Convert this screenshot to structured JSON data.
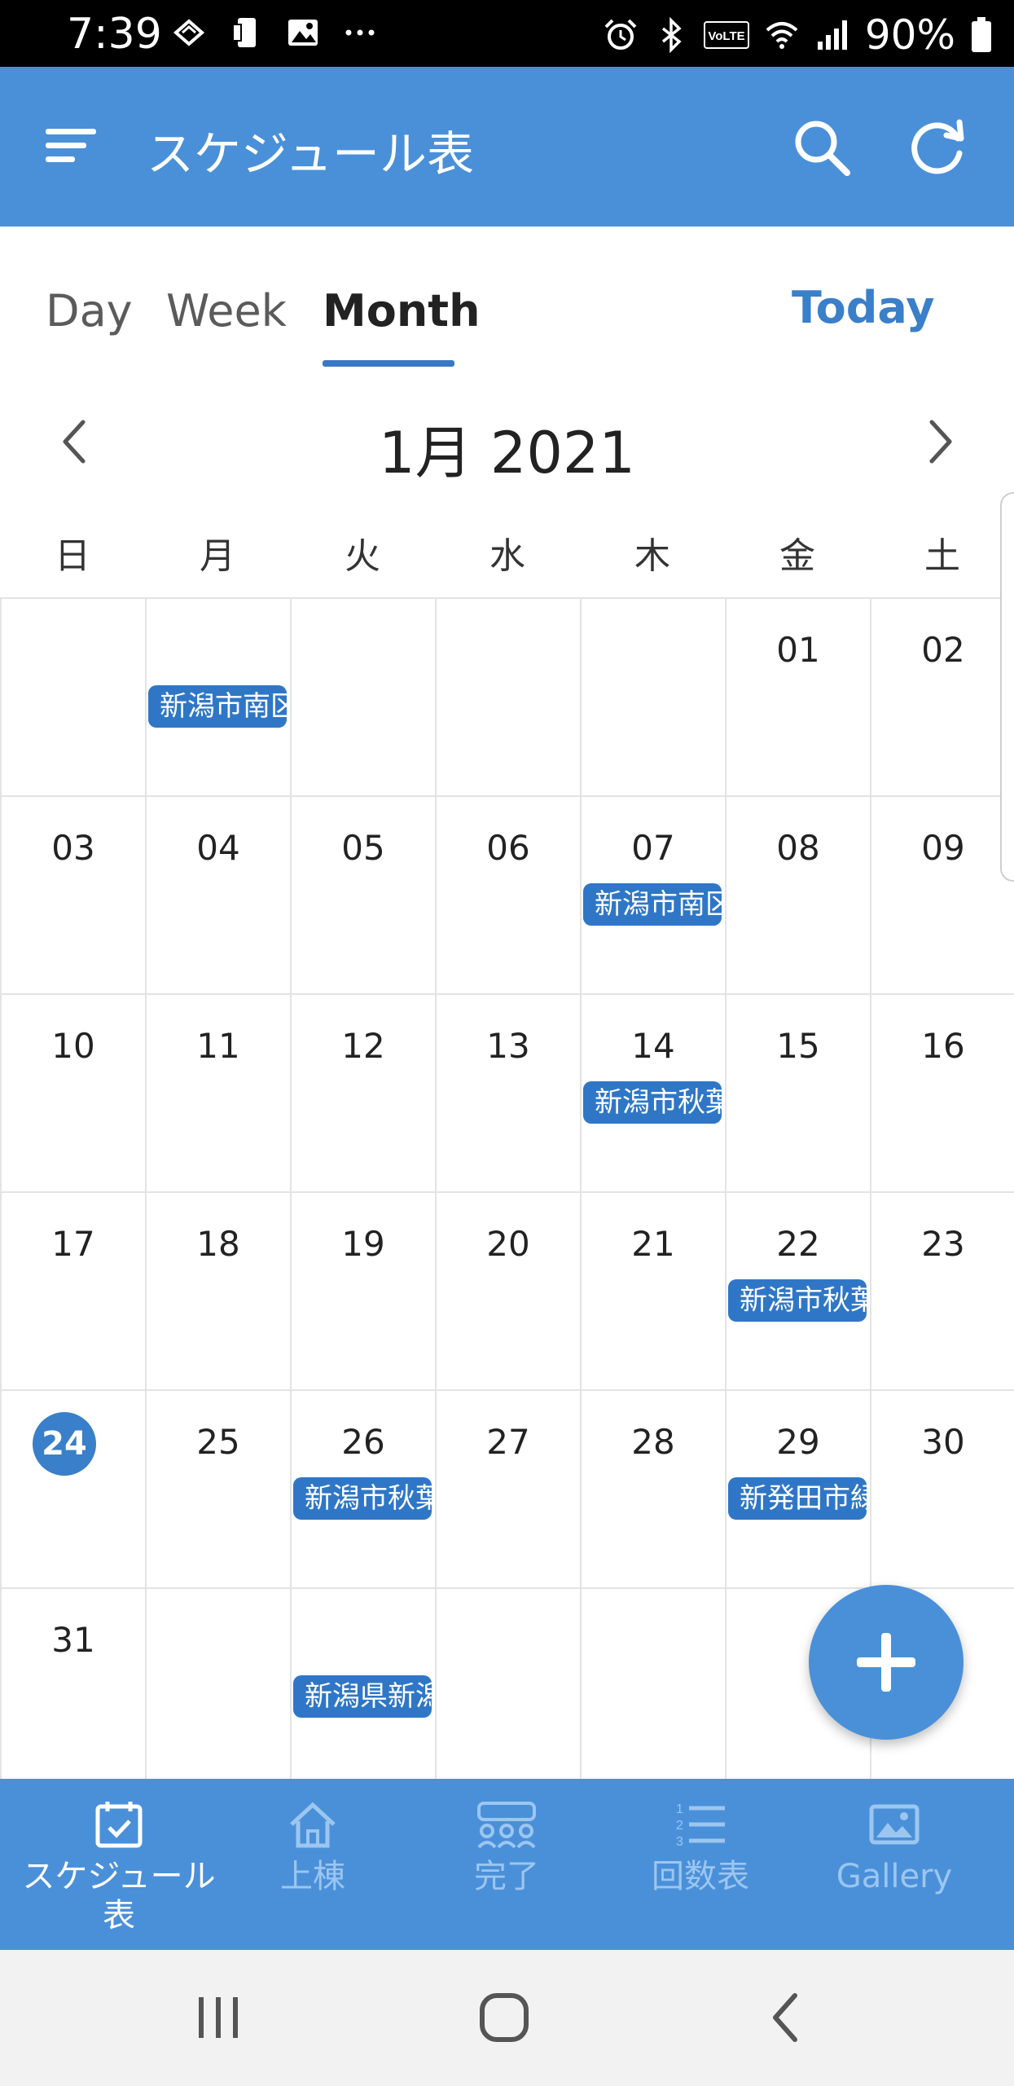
{
  "status_bar": {
    "time": "7:39",
    "battery_pct": "90%",
    "icons_left": [
      "sync-icon",
      "device-icon",
      "image-icon",
      "more-icon"
    ],
    "icons_right": [
      "alarm-icon",
      "bluetooth-icon",
      "volte-icon",
      "wifi-icon",
      "signal-icon",
      "battery-icon"
    ]
  },
  "app_bar": {
    "title": "スケジュール表",
    "accent": "#4a90d9",
    "actions": [
      "search-icon",
      "refresh-icon"
    ]
  },
  "tabs": {
    "items": [
      "Day",
      "Week",
      "Month"
    ],
    "active": "Month",
    "today_label": "Today"
  },
  "calendar": {
    "month_label": "1月 2021",
    "weekdays": [
      "日",
      "月",
      "火",
      "水",
      "木",
      "金",
      "土"
    ],
    "today": "24",
    "weeks": [
      [
        "",
        "",
        "",
        "",
        "",
        "01",
        "02"
      ],
      [
        "03",
        "04",
        "05",
        "06",
        "07",
        "08",
        "09"
      ],
      [
        "10",
        "11",
        "12",
        "13",
        "14",
        "15",
        "16"
      ],
      [
        "17",
        "18",
        "19",
        "20",
        "21",
        "22",
        "23"
      ],
      [
        "24",
        "25",
        "26",
        "27",
        "28",
        "29",
        "30"
      ],
      [
        "31",
        "",
        "",
        "",
        "",
        "",
        ""
      ]
    ],
    "events": [
      {
        "week": 0,
        "day": 1,
        "label": "新潟市南区"
      },
      {
        "week": 1,
        "day": 4,
        "label": "新潟市南区"
      },
      {
        "week": 2,
        "day": 4,
        "label": "新潟市秋葉区"
      },
      {
        "week": 3,
        "day": 5,
        "label": "新潟市秋葉区"
      },
      {
        "week": 4,
        "day": 2,
        "label": "新潟市秋葉区"
      },
      {
        "week": 4,
        "day": 5,
        "label": "新発田市緑町"
      },
      {
        "week": 5,
        "day": 2,
        "label": "新潟県新潟市"
      }
    ],
    "event_color": "#2f77c6"
  },
  "fab": {
    "icon": "plus-icon"
  },
  "bottom_nav": {
    "items": [
      {
        "label": "スケジュール\n表",
        "icon": "calendar-check-icon",
        "active": true
      },
      {
        "label": "上棟",
        "icon": "home-icon",
        "active": false
      },
      {
        "label": "完了",
        "icon": "group-icon",
        "active": false
      },
      {
        "label": "回数表",
        "icon": "numbered-list-icon",
        "active": false
      },
      {
        "label": "Gallery",
        "icon": "image-icon",
        "active": false
      }
    ]
  },
  "system_nav": [
    "recents-icon",
    "home-circle-icon",
    "back-icon"
  ]
}
